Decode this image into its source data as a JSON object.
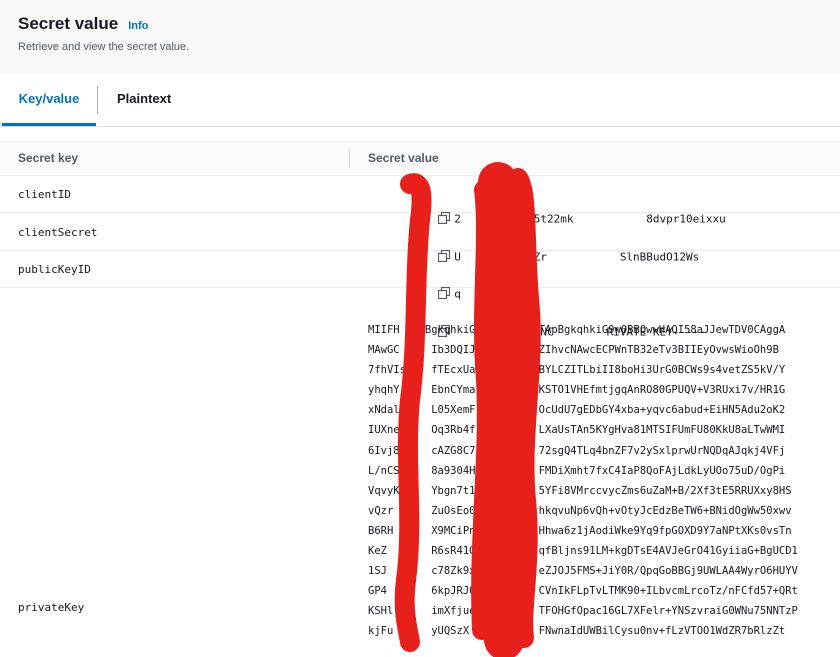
{
  "header": {
    "title": "Secret value",
    "info_label": "Info",
    "subtitle": "Retrieve and view the secret value."
  },
  "tabs": [
    {
      "label": "Key/value",
      "active": true
    },
    {
      "label": "Plaintext",
      "active": false
    }
  ],
  "table": {
    "columns": [
      "Secret key",
      "Secret value"
    ],
    "rows": [
      {
        "key": "clientID",
        "value": "2         cz5t22mk           8dvpr10eixxu"
      },
      {
        "key": "clientSecret",
        "value": "U    S40pQ5xZr           SlnBBudO12Ws"
      },
      {
        "key": "publicKeyID",
        "value": "q     ehh4"
      },
      {
        "key": "privateKey",
        "value": "     -BEGIN ENC        RIVATE KEY-----"
      }
    ],
    "private_key_lines": [
      "MIIFH    BgkqhkiG9         TApBgkqhkiG9w0BBQwwHAQI58aJJewTDV0CAggA",
      "MAwGC     Ib3DQIJ          ZIhvcNAwcECPWnTB32eTv3BIIEyOvwsWioOh9B",
      "7fhVIs    fTEcxUa          BYLCZITLbiII8boHi3UrG0BCWs9s4vetZS5kV/Y",
      "yhqhY     EbnCYma          KSTO1VHEfmtjgqAnRO80GPUQV+V3RUxi7v/HR1G",
      "xNdalN    L05XemF          OcUdU7gEDbGY4xba+yqvc6abud+EiHN5Adu2oK2",
      "IUXne5    Oq3Rb4f          LXaUsTAn5KYgHva81MTSIFUmFU80KkU8aLTwWMI",
      "6Ivj8U    cAZG8C7          72sgQ4TLq4bnZF7v2ySxlprwUrNQDqAJqkj4VFj",
      "L/nCS     8a9304H          FMDiXmht7fxC4IaP8QoFAjLdkLyUOo75uD/OgPi",
      "VqvyK     Ybgn7t1          5YFi8VMrccvycZms6uZaM+B/2Xf3tE5RRUXxy8HS",
      "vQzr      ZuOsEo0          hkqvuNp6vQh+vOtyJcEdzBeTW6+BNidOgWw50xwv",
      "B6RH      X9MCiPnZ         Hhwa6z1jAodiWke9Yq9fpGOXD9Y7aNPtXKs0vsTn",
      "KeZ       R6sR41G2         qfBljns91LM+kgDTsE4AVJeGrO41GyiiaG+BgUCD1",
      "1SJ       c78Zk9xhF        eZJOJ5FMS+JiY0R/QpqGoBBGj9UWLAA4WyrO6HUYV",
      "GP4       6kpJRJ0B         CVnIkFLpTvLTMK90+ILbvcmLrcoTz/nFCfd57+QRt",
      "KSHl      imXfjuel         TFOHGfOpac16GL7XFelr+YNSzvraiG0WNu75NNTzP",
      "kjFu      yUQSzX           FNwnaIdUWBilCysu0nv+fLzVTOO1WdZR7bRlzZt"
    ]
  },
  "colors": {
    "accent": "#0073bb",
    "redaction": "#e8201b"
  }
}
